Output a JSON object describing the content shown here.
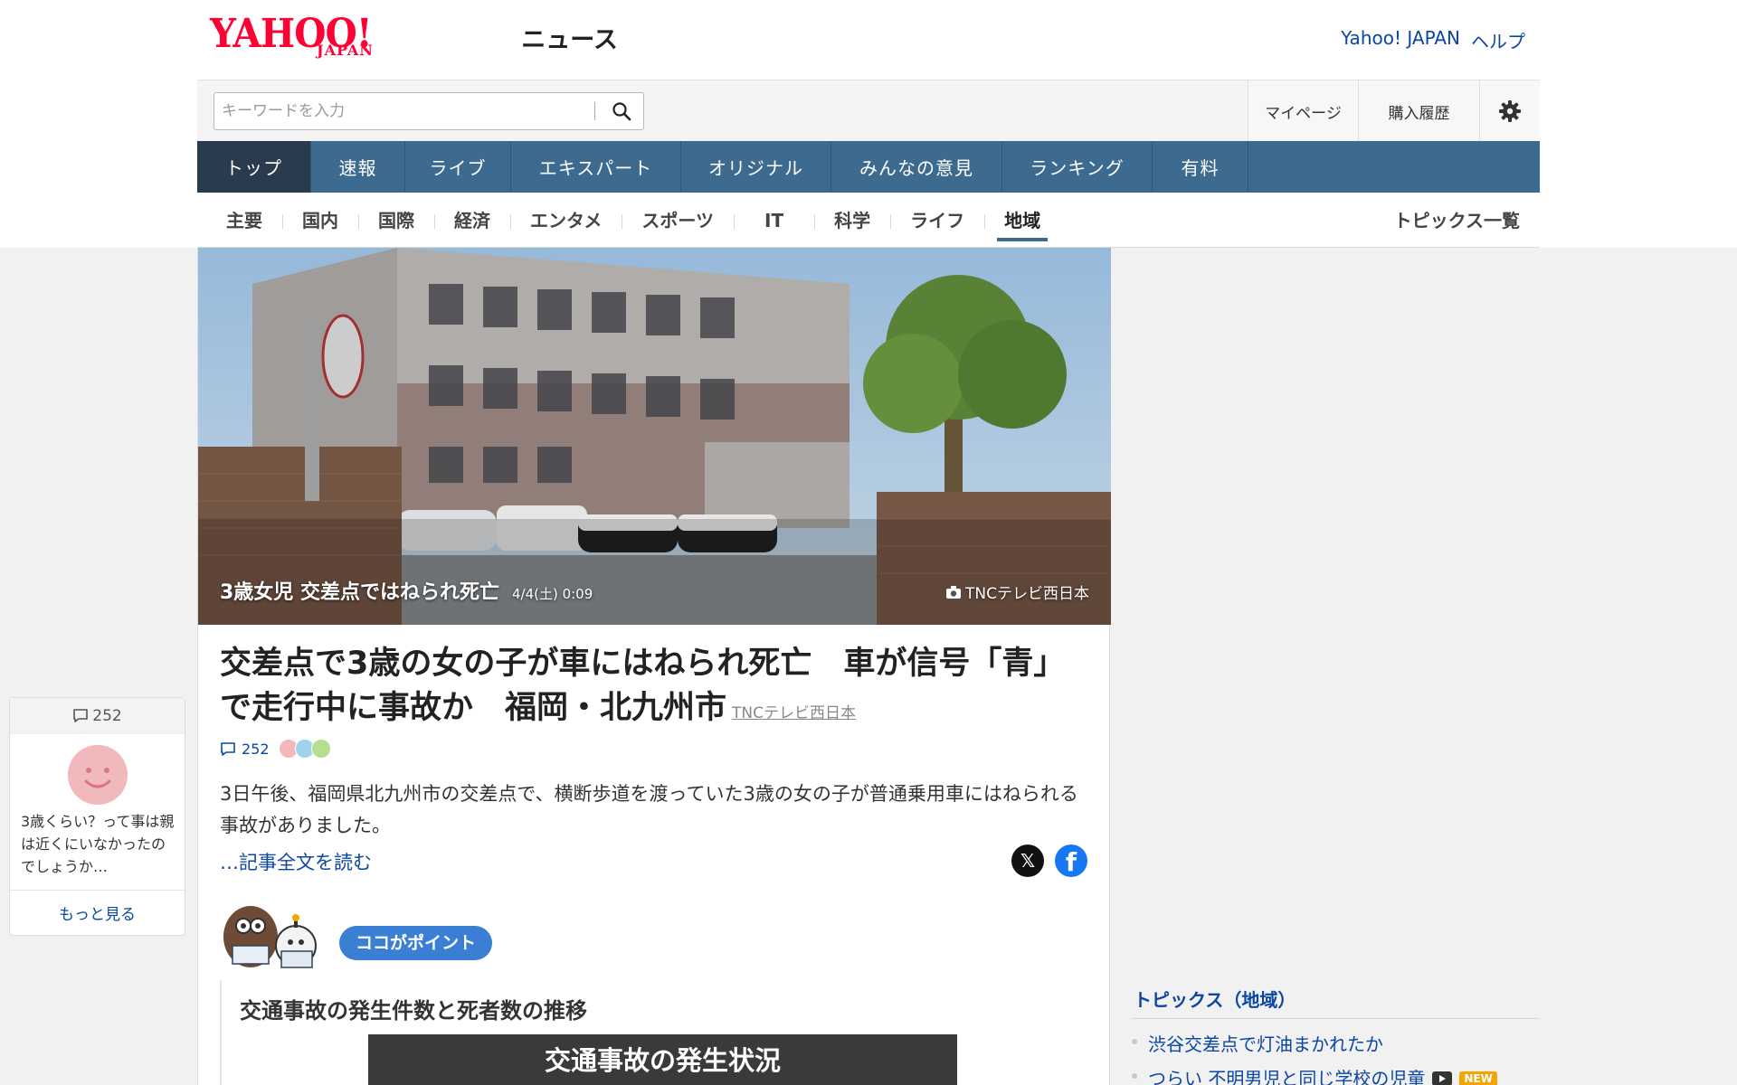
{
  "header": {
    "logo_main": "YAHOO!",
    "logo_sub": "JAPAN",
    "logo_service": "ニュース",
    "links": [
      "Yahoo! JAPAN",
      "ヘルプ"
    ]
  },
  "search": {
    "placeholder": "キーワードを入力",
    "value": ""
  },
  "utility": {
    "mypage": "マイページ",
    "history": "購入履歴",
    "settings_icon": "gear-icon"
  },
  "main_nav": {
    "tabs": [
      {
        "label": "トップ",
        "active": true
      },
      {
        "label": "速報"
      },
      {
        "label": "ライブ"
      },
      {
        "label": "エキスパート"
      },
      {
        "label": "オリジナル"
      },
      {
        "label": "みんなの意見"
      },
      {
        "label": "ランキング"
      },
      {
        "label": "有料"
      }
    ]
  },
  "sub_nav": {
    "items": [
      {
        "label": "主要"
      },
      {
        "label": "国内"
      },
      {
        "label": "国際"
      },
      {
        "label": "経済"
      },
      {
        "label": "エンタメ"
      },
      {
        "label": "スポーツ"
      },
      {
        "label": "IT"
      },
      {
        "label": "科学"
      },
      {
        "label": "ライフ"
      },
      {
        "label": "地域",
        "active": true
      }
    ],
    "all_topics": "トピックス一覧"
  },
  "article": {
    "hero_title": "3歳女児 交差点ではねられ死亡",
    "hero_date": "4/4(土) 0:09",
    "hero_credit": "TNCテレビ西日本",
    "headline": "交差点で3歳の女の子が車にはねられ死亡　車が信号「青」で走行中に事故か　福岡・北九州市",
    "source": "TNCテレビ西日本",
    "comment_count": "252",
    "summary": "3日午後、福岡県北九州市の交差点で、横断歩道を渡っていた3歳の女の子が普通乗用車にはねられる事故がありました。",
    "read_more": "…記事全文を読む",
    "point_label": "ココがポイント",
    "chart_heading": "交通事故の発生件数と死者数の推移",
    "chart_banner": "交通事故の発生状況",
    "colors": {
      "accent": "#3d6b8f",
      "link": "#0b46a3",
      "point": "#3a7fd4"
    }
  },
  "comment_widget": {
    "count": "252",
    "text": "3歳くらい？って事は親は近くにいなかったのでしょうか…",
    "more": "もっと見る"
  },
  "sidebar": {
    "title": "トピックス（地域）",
    "items": [
      {
        "label": "渋谷交差点で灯油まかれたか"
      },
      {
        "label": "つらい 不明男児と同じ学校の児童",
        "video": true,
        "badge": "NEW"
      }
    ]
  }
}
